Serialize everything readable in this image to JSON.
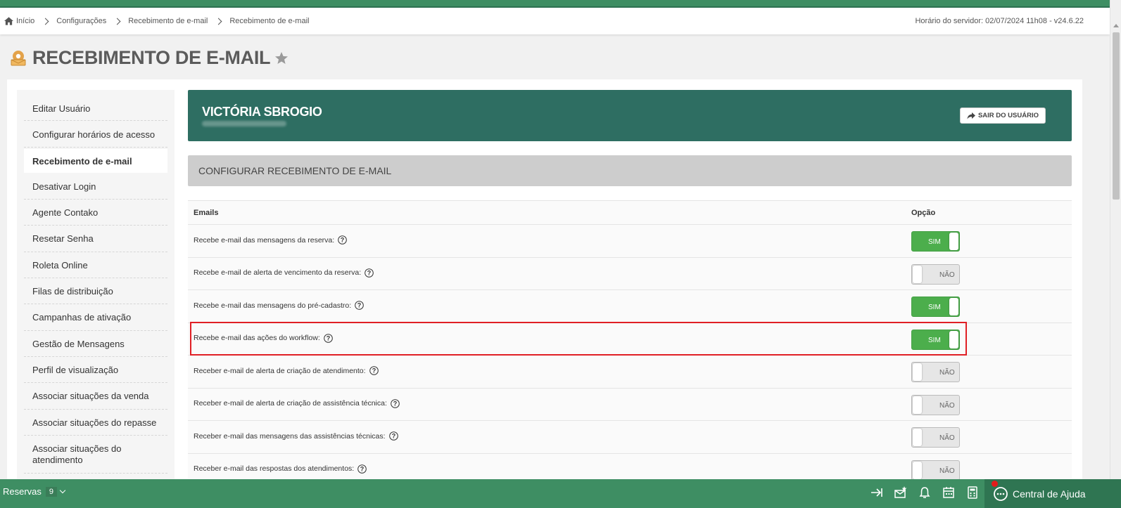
{
  "breadcrumb": {
    "items": [
      "Início",
      "Configurações",
      "Recebimento de e-mail",
      "Recebimento de e-mail"
    ],
    "server_time": "Horário do servidor: 02/07/2024 11h08 - v24.6.22"
  },
  "page": {
    "title": "RECEBIMENTO DE E-MAIL"
  },
  "sidebar": {
    "items": [
      {
        "label": "Editar Usuário",
        "active": false
      },
      {
        "label": "Configurar horários de acesso",
        "active": false
      },
      {
        "label": "Recebimento de e-mail",
        "active": true
      },
      {
        "label": "Desativar Login",
        "active": false
      },
      {
        "label": "Agente Contako",
        "active": false
      },
      {
        "label": "Resetar Senha",
        "active": false
      },
      {
        "label": "Roleta Online",
        "active": false
      },
      {
        "label": "Filas de distribuição",
        "active": false
      },
      {
        "label": "Campanhas de ativação",
        "active": false
      },
      {
        "label": "Gestão de Mensagens",
        "active": false
      },
      {
        "label": "Perfil de visualização",
        "active": false
      },
      {
        "label": "Associar situações da venda",
        "active": false
      },
      {
        "label": "Associar situações do repasse",
        "active": false
      },
      {
        "label": "Associar situações do atendimento",
        "active": false
      }
    ]
  },
  "user": {
    "name": "VICTÓRIA SBROGIO",
    "logout_label": "SAIR DO USUÁRIO"
  },
  "section": {
    "title": "CONFIGURAR RECEBIMENTO DE E-MAIL"
  },
  "table": {
    "headers": [
      "Emails",
      "Opção"
    ],
    "rows": [
      {
        "label": "Recebe e-mail das mensagens da reserva:",
        "value": "SIM",
        "on": true
      },
      {
        "label": "Recebe e-mail de alerta de vencimento da reserva:",
        "value": "NÃO",
        "on": false
      },
      {
        "label": "Recebe e-mail das mensagens do pré-cadastro:",
        "value": "SIM",
        "on": true
      },
      {
        "label": "Recebe e-mail das ações do workflow:",
        "value": "SIM",
        "on": true,
        "highlighted": true
      },
      {
        "label": "Receber e-mail de alerta de criação de atendimento:",
        "value": "NÃO",
        "on": false
      },
      {
        "label": "Receber e-mail de alerta de criação de assistência técnica:",
        "value": "NÃO",
        "on": false
      },
      {
        "label": "Receber e-mail das mensagens das assistências técnicas:",
        "value": "NÃO",
        "on": false
      },
      {
        "label": "Receber e-mail das respostas dos atendimentos:",
        "value": "NÃO",
        "on": false
      }
    ]
  },
  "bottom_bar": {
    "reservas_label": "Reservas",
    "reservas_count": "9",
    "help_center": "Central de Ajuda"
  },
  "colors": {
    "brand_green": "#3e8e63",
    "user_card": "#2e6e62",
    "toggle_on": "#4cae4c",
    "highlight": "#e01f25"
  }
}
